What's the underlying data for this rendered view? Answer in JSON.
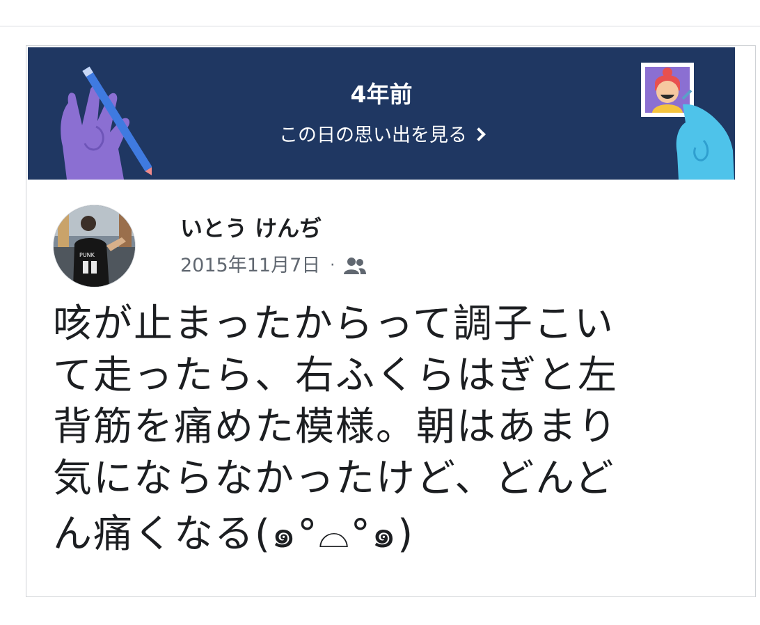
{
  "memory_banner": {
    "years_ago": "4年前",
    "see_memories_link": "この日の思い出を見る"
  },
  "post": {
    "author_name": "いとう けんぢ",
    "date": "2015年11月7日",
    "separator": "·",
    "audience_icon": "friends-icon",
    "text_lines": [
      "咳が止まったからって調子こい",
      "て走ったら、右ふくらはぎと左",
      "背筋を痛めた模様。朝はあまり",
      "気にならなかったけど、どんど",
      "ん痛くなる(๑°⌓°๑)"
    ]
  },
  "colors": {
    "banner_bg": "#1f3762",
    "hand_left": "#8b6fd2",
    "hand_right": "#4ec3ea",
    "pencil": "#3f7ae0",
    "text_primary": "#1c1e21",
    "text_secondary": "#606770"
  }
}
